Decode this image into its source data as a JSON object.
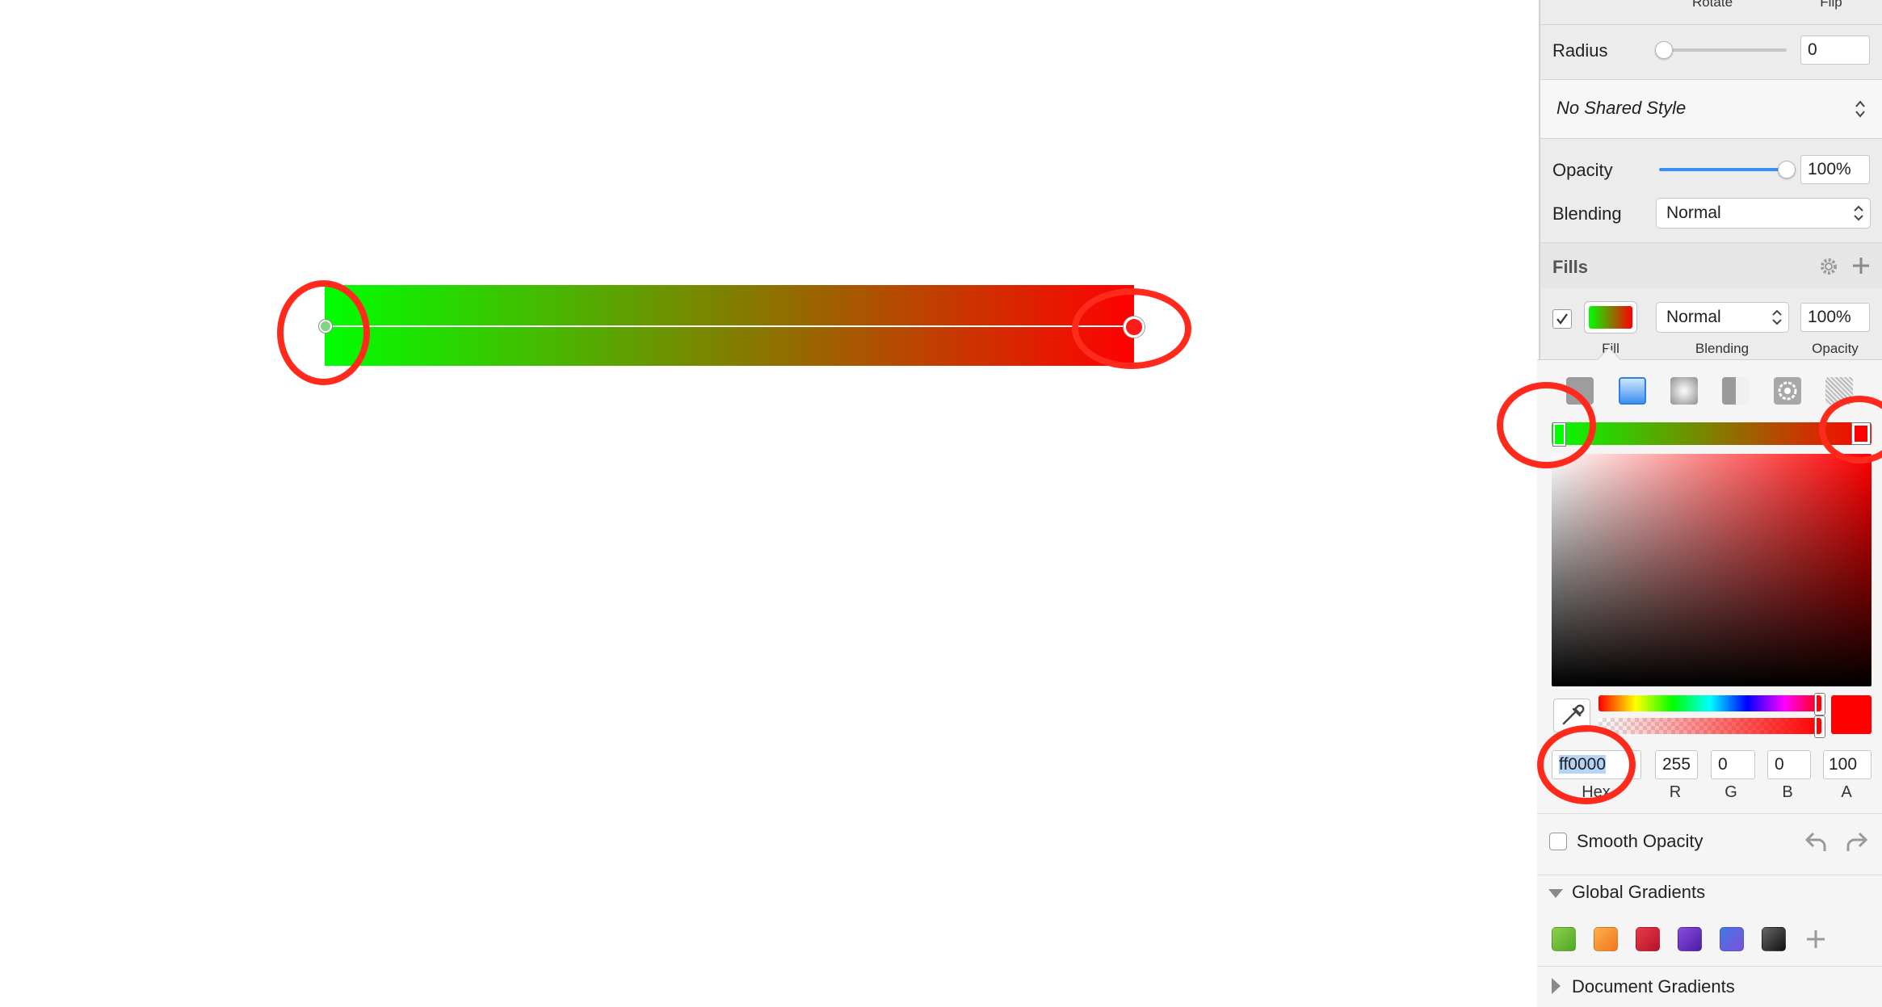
{
  "inspector": {
    "header_labels": {
      "rotate": "Rotate",
      "flip": "Flip"
    },
    "radius": {
      "label": "Radius",
      "value": "0"
    },
    "shared_style": {
      "value": "No Shared Style"
    },
    "opacity": {
      "label": "Opacity",
      "value": "100%",
      "slider_fraction": 1.0
    },
    "blending": {
      "label": "Blending",
      "value": "Normal"
    },
    "fills": {
      "title": "Fills",
      "row": {
        "checked": true,
        "blend_value": "Normal",
        "opacity_value": "100%",
        "caption_fill": "Fill",
        "caption_blending": "Blending",
        "caption_opacity": "Opacity"
      }
    }
  },
  "color_picker": {
    "fill_types": [
      "solid-fill-icon",
      "linear-gradient-icon",
      "radial-gradient-icon",
      "angular-gradient-icon",
      "pattern-fill-icon",
      "noise-fill-icon"
    ],
    "gradient": {
      "start_color": "#00ff00",
      "end_color": "#ff0000"
    },
    "hex": {
      "value": "ff0000",
      "label": "Hex"
    },
    "r": {
      "value": "255",
      "label": "R"
    },
    "g": {
      "value": "0",
      "label": "G"
    },
    "b": {
      "value": "0",
      "label": "B"
    },
    "a": {
      "value": "100",
      "label": "A"
    },
    "smooth_opacity": {
      "label": "Smooth Opacity",
      "checked": false
    },
    "global_gradients": {
      "label": "Global Gradients",
      "swatches": [
        {
          "from": "#8ed04a",
          "to": "#4fa829"
        },
        {
          "from": "#fdb04d",
          "to": "#f2761c"
        },
        {
          "from": "#e83a4a",
          "to": "#b4142a"
        },
        {
          "from": "#8a4be0",
          "to": "#4a1ea4"
        },
        {
          "from": "#3f7ae8",
          "to": "#7f50d6"
        },
        {
          "from": "#666666",
          "to": "#111111"
        }
      ]
    },
    "document_gradients": {
      "label": "Document Gradients"
    }
  },
  "colors": {
    "annotation": "#ff2a1c",
    "accent": "#3b8ef3"
  }
}
